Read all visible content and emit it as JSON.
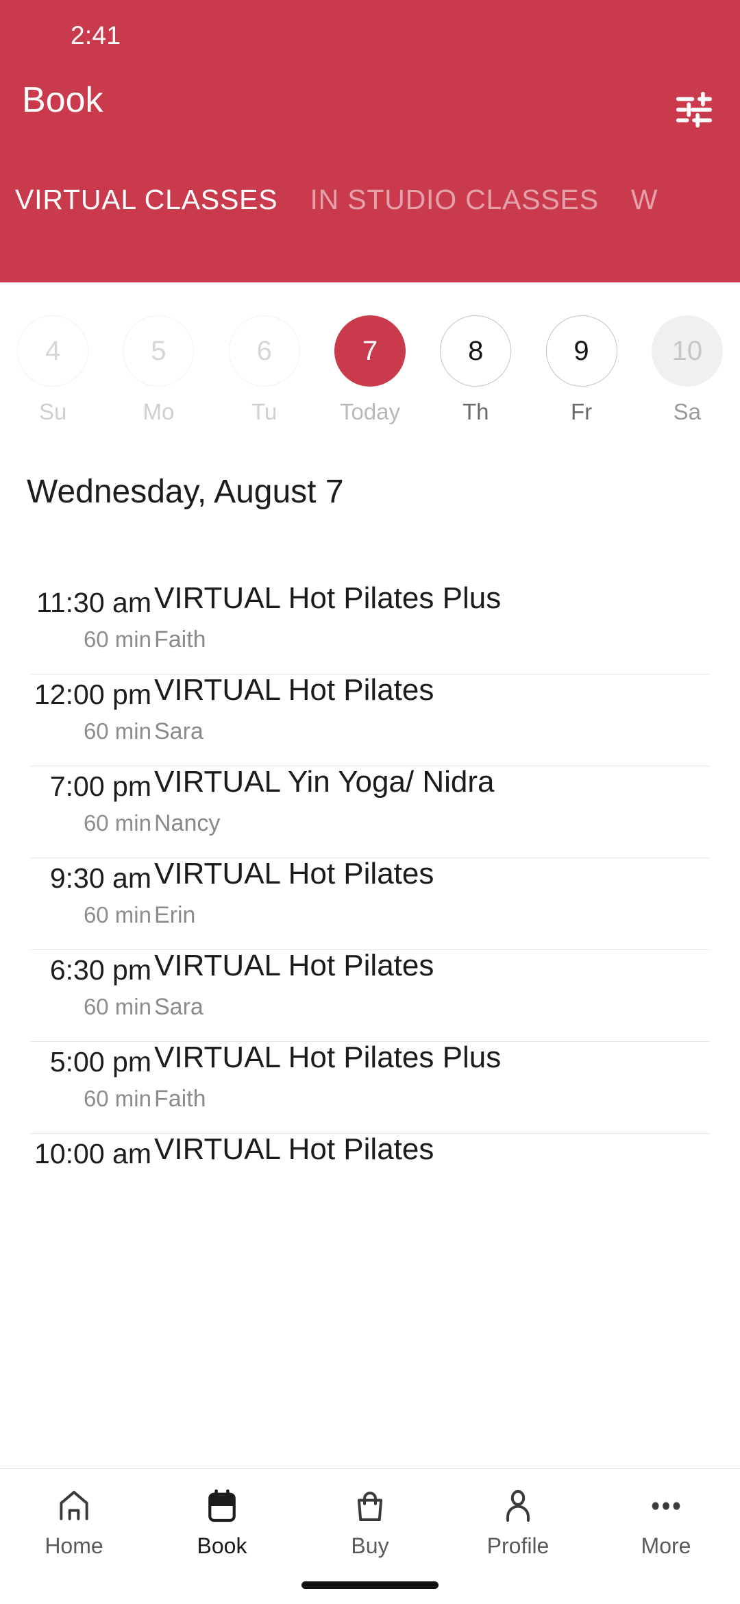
{
  "status_bar": {
    "time": "2:41"
  },
  "header": {
    "title": "Book",
    "accent_color": "#c93b4c",
    "filter_icon": "tune-icon",
    "tabs": [
      {
        "label": "VIRTUAL CLASSES",
        "active": true
      },
      {
        "label": "IN STUDIO CLASSES",
        "active": false
      },
      {
        "label": "W",
        "active": false
      }
    ]
  },
  "date_strip": {
    "days": [
      {
        "num": "4",
        "weekday": "Su",
        "state": "past"
      },
      {
        "num": "5",
        "weekday": "Mo",
        "state": "past"
      },
      {
        "num": "6",
        "weekday": "Tu",
        "state": "past"
      },
      {
        "num": "7",
        "weekday": "Today",
        "state": "today"
      },
      {
        "num": "8",
        "weekday": "Th",
        "state": "future"
      },
      {
        "num": "9",
        "weekday": "Fr",
        "state": "future"
      },
      {
        "num": "10",
        "weekday": "Sa",
        "state": "muted"
      }
    ]
  },
  "schedule": {
    "day_heading": "Wednesday, August 7",
    "classes": [
      {
        "time": "11:30 am",
        "duration": "60 min",
        "name": "VIRTUAL Hot Pilates Plus",
        "instructor": "Faith"
      },
      {
        "time": "12:00 pm",
        "duration": "60 min",
        "name": "VIRTUAL Hot Pilates",
        "instructor": "Sara"
      },
      {
        "time": "7:00 pm",
        "duration": "60 min",
        "name": "VIRTUAL Yin Yoga/ Nidra",
        "instructor": "Nancy"
      },
      {
        "time": "9:30 am",
        "duration": "60 min",
        "name": "VIRTUAL Hot Pilates",
        "instructor": "Erin"
      },
      {
        "time": "6:30 pm",
        "duration": "60 min",
        "name": "VIRTUAL Hot Pilates",
        "instructor": "Sara"
      },
      {
        "time": "5:00 pm",
        "duration": "60 min",
        "name": "VIRTUAL Hot Pilates Plus",
        "instructor": "Faith"
      },
      {
        "time": "10:00 am",
        "duration": "",
        "name": "VIRTUAL Hot Pilates",
        "instructor": ""
      }
    ]
  },
  "bottom_nav": {
    "items": [
      {
        "label": "Home",
        "icon": "home-icon",
        "active": false
      },
      {
        "label": "Book",
        "icon": "calendar-icon",
        "active": true
      },
      {
        "label": "Buy",
        "icon": "bag-icon",
        "active": false
      },
      {
        "label": "Profile",
        "icon": "person-icon",
        "active": false
      },
      {
        "label": "More",
        "icon": "ellipsis-icon",
        "active": false
      }
    ]
  }
}
